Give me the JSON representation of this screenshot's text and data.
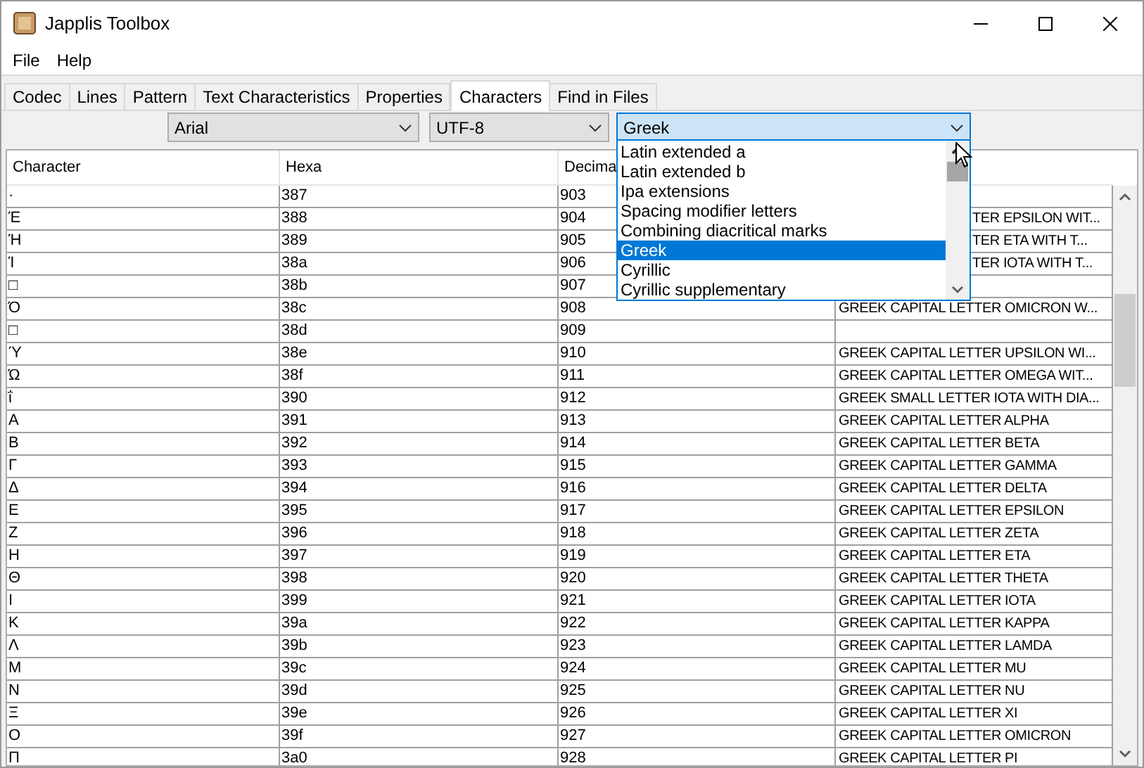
{
  "window": {
    "title": "Japplis Toolbox"
  },
  "menu": [
    "File",
    "Help"
  ],
  "tabs": [
    {
      "label": "Codec",
      "selected": false
    },
    {
      "label": "Lines",
      "selected": false
    },
    {
      "label": "Pattern",
      "selected": false
    },
    {
      "label": "Text Characteristics",
      "selected": false
    },
    {
      "label": "Properties",
      "selected": false
    },
    {
      "label": "Characters",
      "selected": true
    },
    {
      "label": "Find in Files",
      "selected": false
    }
  ],
  "font_combo": {
    "value": "Arial"
  },
  "encoding_combo": {
    "value": "UTF-8"
  },
  "block_combo": {
    "value": "Greek",
    "expanded": true,
    "options": [
      {
        "label": "Latin extended a",
        "selected": false
      },
      {
        "label": "Latin extended b",
        "selected": false
      },
      {
        "label": "Ipa extensions",
        "selected": false
      },
      {
        "label": "Spacing modifier letters",
        "selected": false
      },
      {
        "label": "Combining diacritical marks",
        "selected": false
      },
      {
        "label": "Greek",
        "selected": true
      },
      {
        "label": "Cyrillic",
        "selected": false
      },
      {
        "label": "Cyrillic supplementary",
        "selected": false
      }
    ]
  },
  "table": {
    "columns": [
      "Character",
      "Hexa",
      "Decima"
    ],
    "rows": [
      {
        "character": "·",
        "hexa": "387",
        "decimal": "903",
        "name": ""
      },
      {
        "character": "Έ",
        "hexa": "388",
        "decimal": "904",
        "name": "TER EPSILON WIT...",
        "covered": true
      },
      {
        "character": "Ή",
        "hexa": "389",
        "decimal": "905",
        "name": "TER ETA WITH T...",
        "covered": true
      },
      {
        "character": "Ί",
        "hexa": "38a",
        "decimal": "906",
        "name": "TER IOTA WITH T...",
        "covered": true
      },
      {
        "character": "□",
        "hexa": "38b",
        "decimal": "907",
        "name": ""
      },
      {
        "character": "Ό",
        "hexa": "38c",
        "decimal": "908",
        "name": "GREEK CAPITAL LETTER OMICRON W...",
        "covered": false
      },
      {
        "character": "□",
        "hexa": "38d",
        "decimal": "909",
        "name": ""
      },
      {
        "character": "Ύ",
        "hexa": "38e",
        "decimal": "910",
        "name": "GREEK CAPITAL LETTER UPSILON WI...",
        "covered": false
      },
      {
        "character": "Ώ",
        "hexa": "38f",
        "decimal": "911",
        "name": "GREEK CAPITAL LETTER OMEGA WIT...",
        "covered": false
      },
      {
        "character": "ΐ",
        "hexa": "390",
        "decimal": "912",
        "name": "GREEK SMALL LETTER IOTA WITH DIA...",
        "covered": false
      },
      {
        "character": "Α",
        "hexa": "391",
        "decimal": "913",
        "name": "GREEK CAPITAL LETTER ALPHA",
        "covered": false
      },
      {
        "character": "Β",
        "hexa": "392",
        "decimal": "914",
        "name": "GREEK CAPITAL LETTER BETA",
        "covered": false
      },
      {
        "character": "Γ",
        "hexa": "393",
        "decimal": "915",
        "name": "GREEK CAPITAL LETTER GAMMA",
        "covered": false
      },
      {
        "character": "Δ",
        "hexa": "394",
        "decimal": "916",
        "name": "GREEK CAPITAL LETTER DELTA",
        "covered": false
      },
      {
        "character": "Ε",
        "hexa": "395",
        "decimal": "917",
        "name": "GREEK CAPITAL LETTER EPSILON",
        "covered": false
      },
      {
        "character": "Ζ",
        "hexa": "396",
        "decimal": "918",
        "name": "GREEK CAPITAL LETTER ZETA",
        "covered": false
      },
      {
        "character": "Η",
        "hexa": "397",
        "decimal": "919",
        "name": "GREEK CAPITAL LETTER ETA",
        "covered": false
      },
      {
        "character": "Θ",
        "hexa": "398",
        "decimal": "920",
        "name": "GREEK CAPITAL LETTER THETA",
        "covered": false
      },
      {
        "character": "Ι",
        "hexa": "399",
        "decimal": "921",
        "name": "GREEK CAPITAL LETTER IOTA",
        "covered": false
      },
      {
        "character": "Κ",
        "hexa": "39a",
        "decimal": "922",
        "name": "GREEK CAPITAL LETTER KAPPA",
        "covered": false
      },
      {
        "character": "Λ",
        "hexa": "39b",
        "decimal": "923",
        "name": "GREEK CAPITAL LETTER LAMDA",
        "covered": false
      },
      {
        "character": "Μ",
        "hexa": "39c",
        "decimal": "924",
        "name": "GREEK CAPITAL LETTER MU",
        "covered": false
      },
      {
        "character": "Ν",
        "hexa": "39d",
        "decimal": "925",
        "name": "GREEK CAPITAL LETTER NU",
        "covered": false
      },
      {
        "character": "Ξ",
        "hexa": "39e",
        "decimal": "926",
        "name": "GREEK CAPITAL LETTER XI",
        "covered": false
      },
      {
        "character": "Ο",
        "hexa": "39f",
        "decimal": "927",
        "name": "GREEK CAPITAL LETTER OMICRON",
        "covered": false
      },
      {
        "character": "Π",
        "hexa": "3a0",
        "decimal": "928",
        "name": "GREEK CAPITAL LETTER PI",
        "covered": false
      }
    ]
  }
}
